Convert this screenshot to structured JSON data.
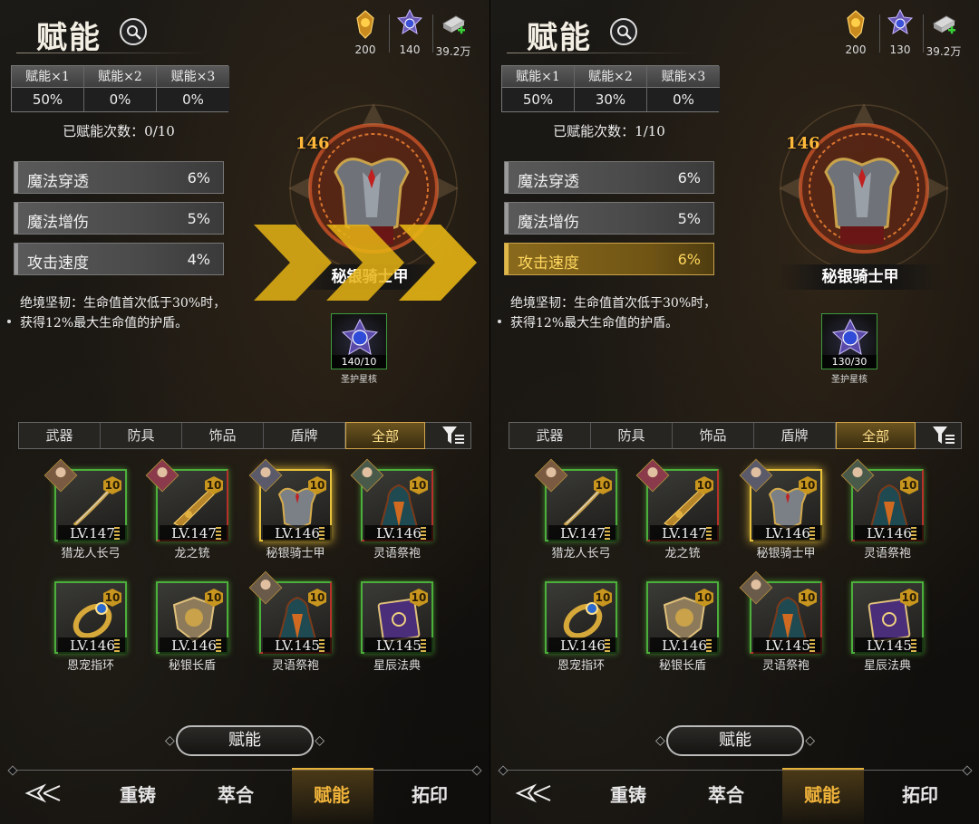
{
  "panels": [
    {
      "title": "赋能",
      "currencies": [
        {
          "icon": "gold-medal-icon",
          "value": "200"
        },
        {
          "icon": "star-core-icon",
          "value": "140"
        },
        {
          "icon": "silver-bar-icon",
          "value": "39.2万"
        }
      ],
      "empower_table": [
        {
          "label": "赋能×1",
          "value": "50%"
        },
        {
          "label": "赋能×2",
          "value": "0%"
        },
        {
          "label": "赋能×3",
          "value": "0%"
        }
      ],
      "count_text": "已赋能次数：0/10",
      "attributes": [
        {
          "name": "魔法穿透",
          "value": "6%",
          "highlighted": false
        },
        {
          "name": "魔法增伤",
          "value": "5%",
          "highlighted": false
        },
        {
          "name": "攻击速度",
          "value": "4%",
          "highlighted": false
        }
      ],
      "description": "绝境坚韧：生命值首次低于30%时，获得12%最大生命值的护盾。",
      "item_level": "146",
      "item_name": "秘银骑士甲",
      "core": {
        "count": "140/10",
        "name": "圣护星核"
      },
      "show_arrows": true
    },
    {
      "title": "赋能",
      "currencies": [
        {
          "icon": "gold-medal-icon",
          "value": "200"
        },
        {
          "icon": "star-core-icon",
          "value": "130"
        },
        {
          "icon": "silver-bar-icon",
          "value": "39.2万"
        }
      ],
      "empower_table": [
        {
          "label": "赋能×1",
          "value": "50%"
        },
        {
          "label": "赋能×2",
          "value": "30%"
        },
        {
          "label": "赋能×3",
          "value": "0%"
        }
      ],
      "count_text": "已赋能次数：1/10",
      "attributes": [
        {
          "name": "魔法穿透",
          "value": "6%",
          "highlighted": false
        },
        {
          "name": "魔法增伤",
          "value": "5%",
          "highlighted": false
        },
        {
          "name": "攻击速度",
          "value": "6%",
          "highlighted": true
        }
      ],
      "description": "绝境坚韧：生命值首次低于30%时，获得12%最大生命值的护盾。",
      "item_level": "146",
      "item_name": "秘银骑士甲",
      "core": {
        "count": "130/30",
        "name": "圣护星核"
      },
      "show_arrows": false
    }
  ],
  "tabs": [
    "武器",
    "防具",
    "饰品",
    "盾牌",
    "全部"
  ],
  "active_tab": "全部",
  "items": [
    {
      "level": "LV.147",
      "name": "猎龙人长弓",
      "badge": "10",
      "selected": false,
      "kind": "bow"
    },
    {
      "level": "LV.147",
      "name": "龙之铳",
      "badge": "10",
      "selected": false,
      "kind": "gun"
    },
    {
      "level": "LV.146",
      "name": "秘银骑士甲",
      "badge": "10",
      "selected": true,
      "kind": "armor"
    },
    {
      "level": "LV.146",
      "name": "灵语祭袍",
      "badge": "10",
      "selected": false,
      "kind": "robe"
    },
    {
      "level": "LV.146",
      "name": "恩宠指环",
      "badge": "10",
      "selected": false,
      "kind": "ring"
    },
    {
      "level": "LV.146",
      "name": "秘银长盾",
      "badge": "10",
      "selected": false,
      "kind": "shield"
    },
    {
      "level": "LV.145",
      "name": "灵语祭袍",
      "badge": "10",
      "selected": false,
      "kind": "robe"
    },
    {
      "level": "LV.145",
      "name": "星辰法典",
      "badge": "10",
      "selected": false,
      "kind": "book"
    }
  ],
  "action_button": "赋能",
  "nav": [
    "重铸",
    "萃合",
    "赋能",
    "拓印"
  ],
  "active_nav": "赋能",
  "colors": {
    "accent_gold": "#e5b03c",
    "highlight_text": "#ffd75e",
    "frame_green": "#4caf3c"
  }
}
